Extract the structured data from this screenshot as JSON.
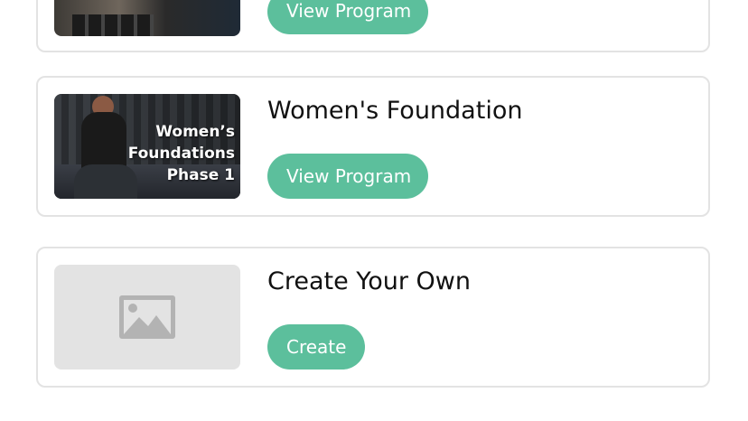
{
  "programs": [
    {
      "button_label": "View Program"
    },
    {
      "title": "Women's Foundation",
      "thumbnail_text": [
        "Women’s",
        "Foundations",
        "Phase 1"
      ],
      "button_label": "View Program"
    },
    {
      "title": "Create Your Own",
      "thumbnail_icon": "image-placeholder-icon",
      "button_label": "Create"
    }
  ],
  "colors": {
    "accent": "#5cbf9c",
    "card_border": "#e3e3e3",
    "placeholder_bg": "#e3e3e3",
    "placeholder_icon": "#b3b3b3"
  }
}
